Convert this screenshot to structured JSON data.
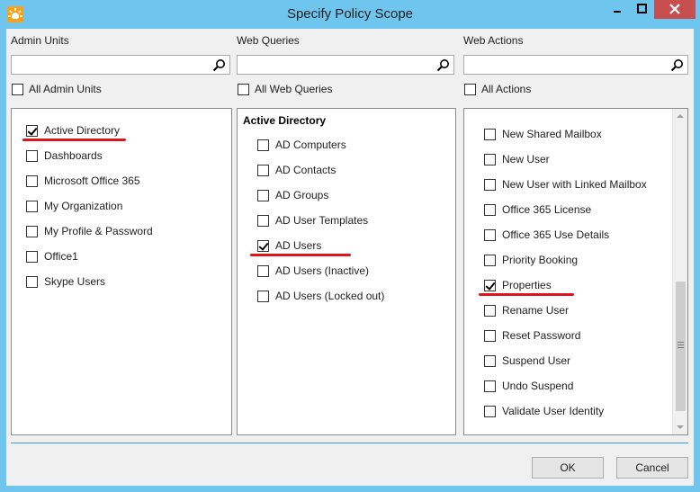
{
  "window": {
    "title": "Specify Policy Scope",
    "accent": "#6ec6ee",
    "close_color": "#c74f4f"
  },
  "columns": {
    "admin_units": {
      "label": "Admin Units",
      "search_value": "",
      "all_label": "All Admin Units",
      "all_checked": false,
      "items": [
        {
          "label": "Active Directory",
          "checked": true
        },
        {
          "label": "Dashboards",
          "checked": false
        },
        {
          "label": "Microsoft Office 365",
          "checked": false
        },
        {
          "label": "My Organization",
          "checked": false
        },
        {
          "label": "My Profile & Password",
          "checked": false
        },
        {
          "label": "Office1",
          "checked": false
        },
        {
          "label": "Skype Users",
          "checked": false
        }
      ]
    },
    "web_queries": {
      "label": "Web Queries",
      "search_value": "",
      "all_label": "All Web Queries",
      "all_checked": false,
      "group_title": "Active Directory",
      "items": [
        {
          "label": "AD Computers",
          "checked": false
        },
        {
          "label": "AD Contacts",
          "checked": false
        },
        {
          "label": "AD Groups",
          "checked": false
        },
        {
          "label": "AD User Templates",
          "checked": false
        },
        {
          "label": "AD Users",
          "checked": true
        },
        {
          "label": "AD Users (Inactive)",
          "checked": false
        },
        {
          "label": "AD Users (Locked out)",
          "checked": false
        }
      ]
    },
    "web_actions": {
      "label": "Web Actions",
      "search_value": "",
      "all_label": "All Actions",
      "all_checked": false,
      "items": [
        {
          "label": "New Shared Mailbox",
          "checked": false
        },
        {
          "label": "New User",
          "checked": false
        },
        {
          "label": "New User with Linked Mailbox",
          "checked": false
        },
        {
          "label": "Office 365 License",
          "checked": false
        },
        {
          "label": "Office 365 Use Details",
          "checked": false
        },
        {
          "label": "Priority Booking",
          "checked": false
        },
        {
          "label": "Properties",
          "checked": true
        },
        {
          "label": "Rename User",
          "checked": false
        },
        {
          "label": "Reset Password",
          "checked": false
        },
        {
          "label": "Suspend User",
          "checked": false
        },
        {
          "label": "Undo Suspend",
          "checked": false
        },
        {
          "label": "Validate User Identity",
          "checked": false
        }
      ]
    }
  },
  "buttons": {
    "ok": "OK",
    "cancel": "Cancel"
  },
  "annotation_color": "#e0121c"
}
